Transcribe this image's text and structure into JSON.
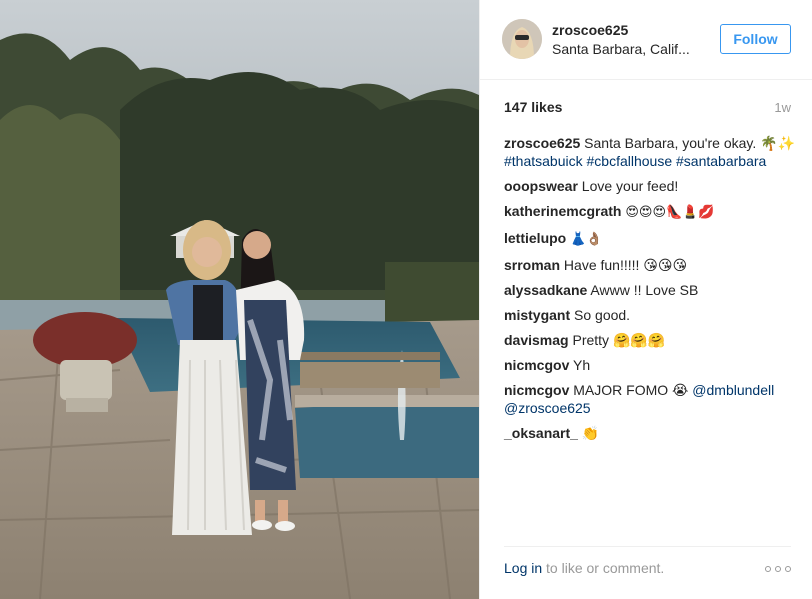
{
  "post": {
    "username": "zroscoe625",
    "location": "Santa Barbara, Calif...",
    "follow_label": "Follow",
    "likes": "147 likes",
    "time_ago": "1w"
  },
  "caption": {
    "author": "zroscoe625",
    "text": "Santa Barbara, you're okay. 🌴✨",
    "hashtags": [
      "#thatsabuick",
      "#cbcfallhouse",
      "#santabarbara"
    ]
  },
  "comments": [
    {
      "author": "ooopswear",
      "text": "Love your feed!"
    },
    {
      "author": "katherinemcgrath",
      "text": "😍😍😍👠💄💋"
    },
    {
      "author": "lettielupo",
      "text": "👗👌🏽"
    },
    {
      "author": "srroman",
      "text": "Have fun!!!!! 😘😘😘"
    },
    {
      "author": "alyssadkane",
      "text": "Awww !! Love SB"
    },
    {
      "author": "mistygant",
      "text": "So good."
    },
    {
      "author": "davismag",
      "text": "Pretty 🤗🤗🤗"
    },
    {
      "author": "nicmcgov",
      "text": "Yh"
    },
    {
      "author": "nicmcgov",
      "text": "MAJOR FOMO 😭",
      "mentions": [
        "@dmblundell",
        "@zroscoe625"
      ]
    },
    {
      "author": "_oksanart_",
      "text": "👏"
    }
  ],
  "footer": {
    "login_link": "Log in",
    "login_text": " to like or comment."
  },
  "colors": {
    "accent": "#3897f0",
    "link": "#003569",
    "muted": "#999999"
  },
  "icons": {
    "more": "more-options-icon"
  }
}
